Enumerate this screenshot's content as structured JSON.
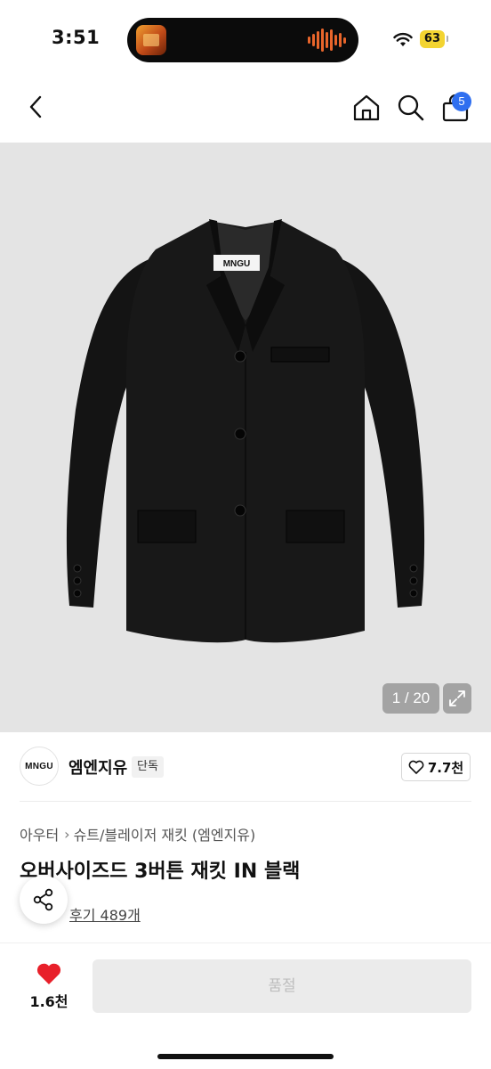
{
  "status_bar": {
    "time": "3:51",
    "battery": "63"
  },
  "nav": {
    "cart_count": "5"
  },
  "product_image": {
    "counter": "1 / 20",
    "label_text": "MNGU"
  },
  "brand": {
    "logo_text": "MNGU",
    "name": "엠엔지유",
    "tag": "단독",
    "likes": "7.7천"
  },
  "breadcrumb": {
    "category": "아우터",
    "subcategory": "슈트/블레이저 재킷 (엠엔지유)"
  },
  "product": {
    "title": "오버사이즈드 3버튼 재킷 IN 블랙",
    "reviews": "후기 489개"
  },
  "bottom_bar": {
    "like_count": "1.6천",
    "soldout_label": "품절"
  },
  "colors": {
    "accent_blue": "#2f6ff0",
    "heart_red": "#e8202a",
    "battery_yellow": "#f3d431"
  }
}
